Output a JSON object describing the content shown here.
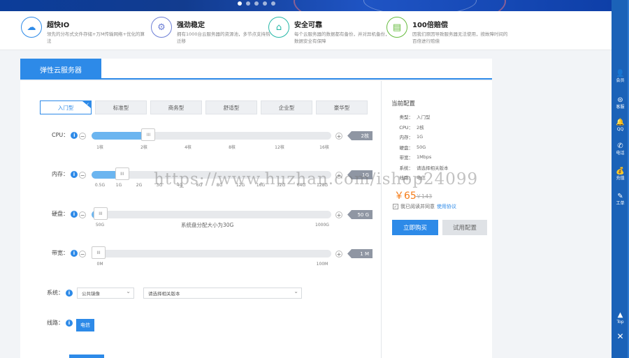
{
  "features": [
    {
      "icon": "cloud-io-icon",
      "glyph": "☁",
      "color": "#2d8ae8",
      "title": "超快IO",
      "desc": "领先的分布式文件存储+万M传输网络+优化的算法"
    },
    {
      "icon": "server-stack-icon",
      "glyph": "⚙",
      "color": "#6d7fd6",
      "title": "强劲稳定",
      "desc": "拥有1000台云服务器的资源池，多节点支持热迁移"
    },
    {
      "icon": "network-icon",
      "glyph": "⌂",
      "color": "#26b7a7",
      "title": "安全可靠",
      "desc": "每个云服务器的数据都有备份，并对异机备份，数据安全有保障"
    },
    {
      "icon": "compensation-icon",
      "glyph": "▤",
      "color": "#66bb3e",
      "title": "100倍赔偿",
      "desc": "因我们原因导致服务器无法使用，按故障时间的百倍进行赔偿"
    }
  ],
  "tab": {
    "label": "弹性云服务器"
  },
  "types": [
    "入门型",
    "标准型",
    "商务型",
    "舒适型",
    "企业型",
    "豪华型"
  ],
  "cpu": {
    "label": "CPU：",
    "value": "2核",
    "fraction": 0.22,
    "ticks": [
      "1核",
      "2核",
      "4核",
      "8核",
      "12核",
      "16核"
    ]
  },
  "memory": {
    "label": "内存：",
    "value": "1G",
    "fraction": 0.11,
    "ticks": [
      "0.5G",
      "1G",
      "2G",
      "3G",
      "4G",
      "6G",
      "8G",
      "12G",
      "16G",
      "32G",
      "64G",
      "128G"
    ]
  },
  "disk": {
    "label": "硬盘：",
    "value": "50 G",
    "fraction": 0.02,
    "ticks": [
      "50G",
      "1000G"
    ],
    "note": "系统盘分配大小为30G"
  },
  "bandwidth": {
    "label": "带宽：",
    "value": "1 M",
    "fraction": 0.01,
    "ticks": [
      "0M",
      "100M"
    ]
  },
  "system": {
    "label": "系统：",
    "select1": "公共镜像",
    "select2": "请选择相关版本"
  },
  "line": {
    "label": "线路：",
    "button": "电信"
  },
  "config": {
    "head": "当前配置",
    "rows": [
      {
        "k": "类型：",
        "v": "入门型"
      },
      {
        "k": "CPU：",
        "v": "2核"
      },
      {
        "k": "内存：",
        "v": "1G"
      },
      {
        "k": "硬盘：",
        "v": "50G"
      },
      {
        "k": "带宽：",
        "v": "1Mbps"
      },
      {
        "k": "系统：",
        "v": "请选择相关版本"
      },
      {
        "k": "线路：",
        "v": "电信"
      }
    ]
  },
  "price": {
    "current": "￥65",
    "old": "￥143"
  },
  "agree": {
    "text": "我已阅读并同意",
    "link": "使用协议"
  },
  "buttons": {
    "buy": "立即购买",
    "try": "试用配置"
  },
  "watermark": "https://www.huzhan.com/ishop24099",
  "sidebar": [
    {
      "icon": "member-icon",
      "glyph": "👤",
      "label": "会员"
    },
    {
      "icon": "recharge-icon",
      "glyph": "⊜",
      "label": "客服"
    },
    {
      "icon": "qq-icon",
      "glyph": "🔔",
      "label": "QQ"
    },
    {
      "icon": "phone-icon",
      "glyph": "✆",
      "label": "电话"
    },
    {
      "icon": "wallet-icon",
      "glyph": "💰",
      "label": "充值"
    },
    {
      "icon": "ticket-icon",
      "glyph": "✎",
      "label": "工单"
    },
    {
      "icon": "top-icon",
      "glyph": "▲",
      "label": "Top"
    },
    {
      "icon": "close-icon",
      "glyph": "✕",
      "label": ""
    }
  ]
}
